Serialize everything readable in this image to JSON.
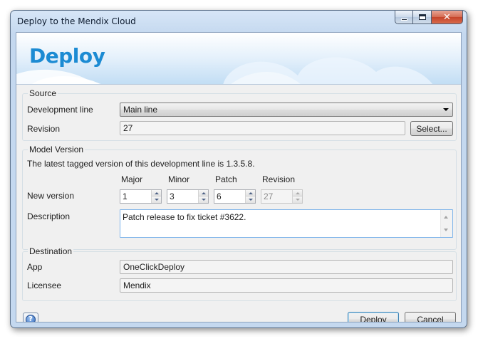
{
  "window": {
    "title": "Deploy to the Mendix Cloud",
    "minimize_glyph": "",
    "maximize_glyph": "",
    "close_glyph": "✕"
  },
  "banner": {
    "title": "Deploy"
  },
  "source": {
    "legend": "Source",
    "development_line_label": "Development line",
    "development_line_value": "Main line",
    "revision_label": "Revision",
    "revision_value": "27",
    "select_button": "Select..."
  },
  "model_version": {
    "legend": "Model Version",
    "latest_text": "The latest tagged version of this development line is 1.3.5.8.",
    "headers": {
      "major": "Major",
      "minor": "Minor",
      "patch": "Patch",
      "revision": "Revision"
    },
    "new_version_label": "New version",
    "values": {
      "major": "1",
      "minor": "3",
      "patch": "6",
      "revision": "27"
    },
    "description_label": "Description",
    "description_value": "Patch release to fix ticket #3622."
  },
  "destination": {
    "legend": "Destination",
    "app_label": "App",
    "app_value": "OneClickDeploy",
    "licensee_label": "Licensee",
    "licensee_value": "Mendix"
  },
  "footer": {
    "help_glyph": "?",
    "deploy_button": "Deploy",
    "cancel_button": "Cancel"
  },
  "icons": [
    "minimize-icon",
    "maximize-icon",
    "close-icon",
    "help-icon",
    "dropdown-arrow-icon",
    "spin-up-icon",
    "spin-down-icon",
    "scroll-up-icon",
    "scroll-down-icon"
  ]
}
